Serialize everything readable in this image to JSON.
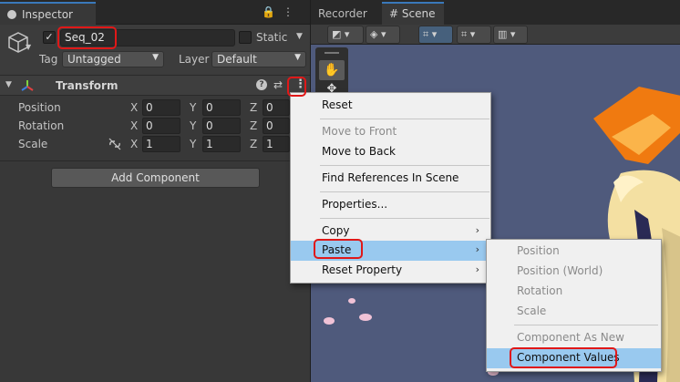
{
  "inspector": {
    "tab_label": "Inspector",
    "object_name": "Seq_02",
    "static_label": "Static",
    "tag_label": "Tag",
    "tag_value": "Untagged",
    "layer_label": "Layer",
    "layer_value": "Default",
    "component_title": "Transform",
    "properties": [
      {
        "label": "Position",
        "x": "0",
        "y": "0",
        "z": "0"
      },
      {
        "label": "Rotation",
        "x": "0",
        "y": "0",
        "z": "0"
      },
      {
        "label": "Scale",
        "x": "1",
        "y": "1",
        "z": "1"
      }
    ],
    "axis_x": "X",
    "axis_y": "Y",
    "axis_z": "Z",
    "add_component_label": "Add Component"
  },
  "scene_panel": {
    "tab_recorder": "Recorder",
    "tab_scene": "Scene"
  },
  "context_menu": {
    "items": [
      {
        "label": "Reset",
        "enabled": true
      },
      {
        "label": "Move to Front",
        "enabled": false
      },
      {
        "label": "Move to Back",
        "enabled": true
      },
      {
        "label": "Find References In Scene",
        "enabled": true
      },
      {
        "label": "Properties...",
        "enabled": true
      },
      {
        "label": "Copy",
        "enabled": true,
        "submenu": true
      },
      {
        "label": "Paste",
        "enabled": true,
        "submenu": true,
        "highlighted": true
      },
      {
        "label": "Reset Property",
        "enabled": true,
        "submenu": true
      }
    ]
  },
  "paste_submenu": {
    "items": [
      {
        "label": "Position",
        "enabled": false
      },
      {
        "label": "Position (World)",
        "enabled": false
      },
      {
        "label": "Rotation",
        "enabled": false
      },
      {
        "label": "Scale",
        "enabled": false
      },
      {
        "label": "Component As New",
        "enabled": false
      },
      {
        "label": "Component Values",
        "enabled": true,
        "highlighted": true
      }
    ]
  },
  "colors": {
    "panel_bg": "#383838",
    "menu_bg": "#f0f0f0",
    "menu_highlight": "#99c9ef",
    "annotation_red": "#e01818",
    "scene_bg": "#4f5a7c"
  }
}
